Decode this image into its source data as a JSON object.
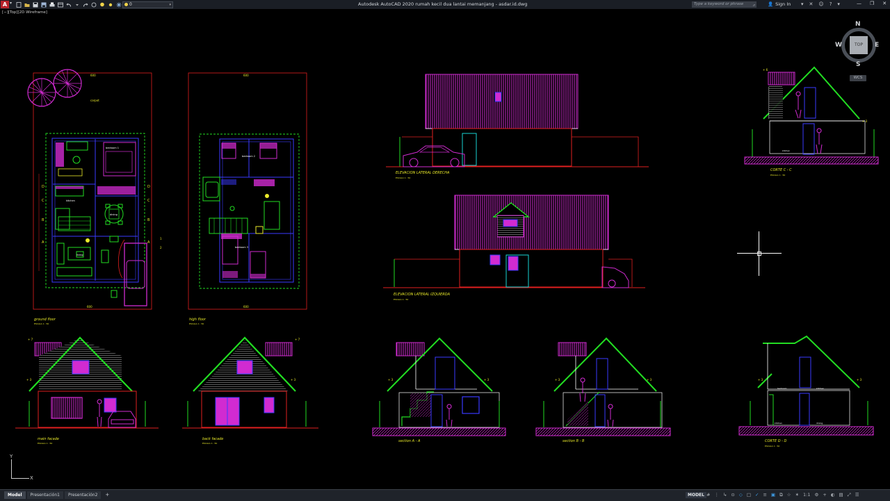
{
  "app": {
    "logo": "A",
    "title_text": "Autodesk AutoCAD 2020   rumah kecil dua lantai memanjang - asdar.id.dwg"
  },
  "quick_access": {
    "icons": [
      "new-icon",
      "open-icon",
      "save-icon",
      "saveas-icon",
      "print-icon",
      "undo-icon",
      "redo-icon",
      "share-icon",
      "bulb-icon",
      "sun-icon",
      "snowflake-icon",
      "layer-color-icon"
    ],
    "layer_current": "0"
  },
  "search": {
    "placeholder": "Type a keyword or phrase"
  },
  "account": {
    "sign_in": "Sign In"
  },
  "viewport": {
    "label": "[−][Top][2D Wireframe]"
  },
  "viewcube": {
    "n": "N",
    "s": "S",
    "e": "E",
    "w": "W",
    "face": "TOP",
    "wcs": "WCS"
  },
  "ucs": {
    "x": "X",
    "y": "Y"
  },
  "drawing": {
    "sheet_labels": {
      "ground_floor": "ground floor",
      "high_floor": "high floor",
      "elev_right": "ELEVACION LATERAL DERECHA",
      "elev_left": "ELEVACION LATERAL IZQUIERDA",
      "corte_c": "CORTE C - C",
      "corte_d": "CORTE D - D",
      "main_facade": "main facade",
      "back_facade": "back facade",
      "section_a": "section A - A",
      "section_b": "section B - B"
    },
    "scale_note": "ESCALA 1 : 50"
  },
  "layout_tabs": [
    "Model",
    "Presentación1",
    "Presentación2"
  ],
  "status": {
    "space": "MODEL",
    "scale": "1:1"
  },
  "colors": {
    "magenta": "#d12bd1",
    "green": "#22dd22",
    "red": "#e01f1f",
    "yellow": "#eaea2a",
    "blue": "#3a3aff",
    "cyan": "#19d5d5",
    "white": "#ffffff"
  }
}
